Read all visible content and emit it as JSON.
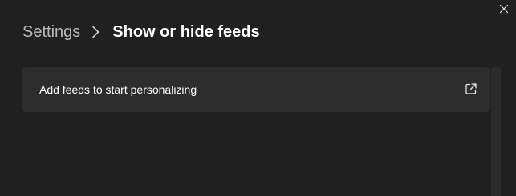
{
  "window": {
    "close_icon": "close-icon"
  },
  "breadcrumb": {
    "parent_label": "Settings",
    "separator_icon": "chevron-right-icon",
    "current_label": "Show or hide feeds"
  },
  "feed_card": {
    "label": "Add feeds to start personalizing",
    "action_icon": "open-external-icon"
  },
  "colors": {
    "background": "#202020",
    "card_background": "#2d2d2d",
    "muted_text": "#b8b8b8",
    "primary_text": "#ffffff"
  }
}
